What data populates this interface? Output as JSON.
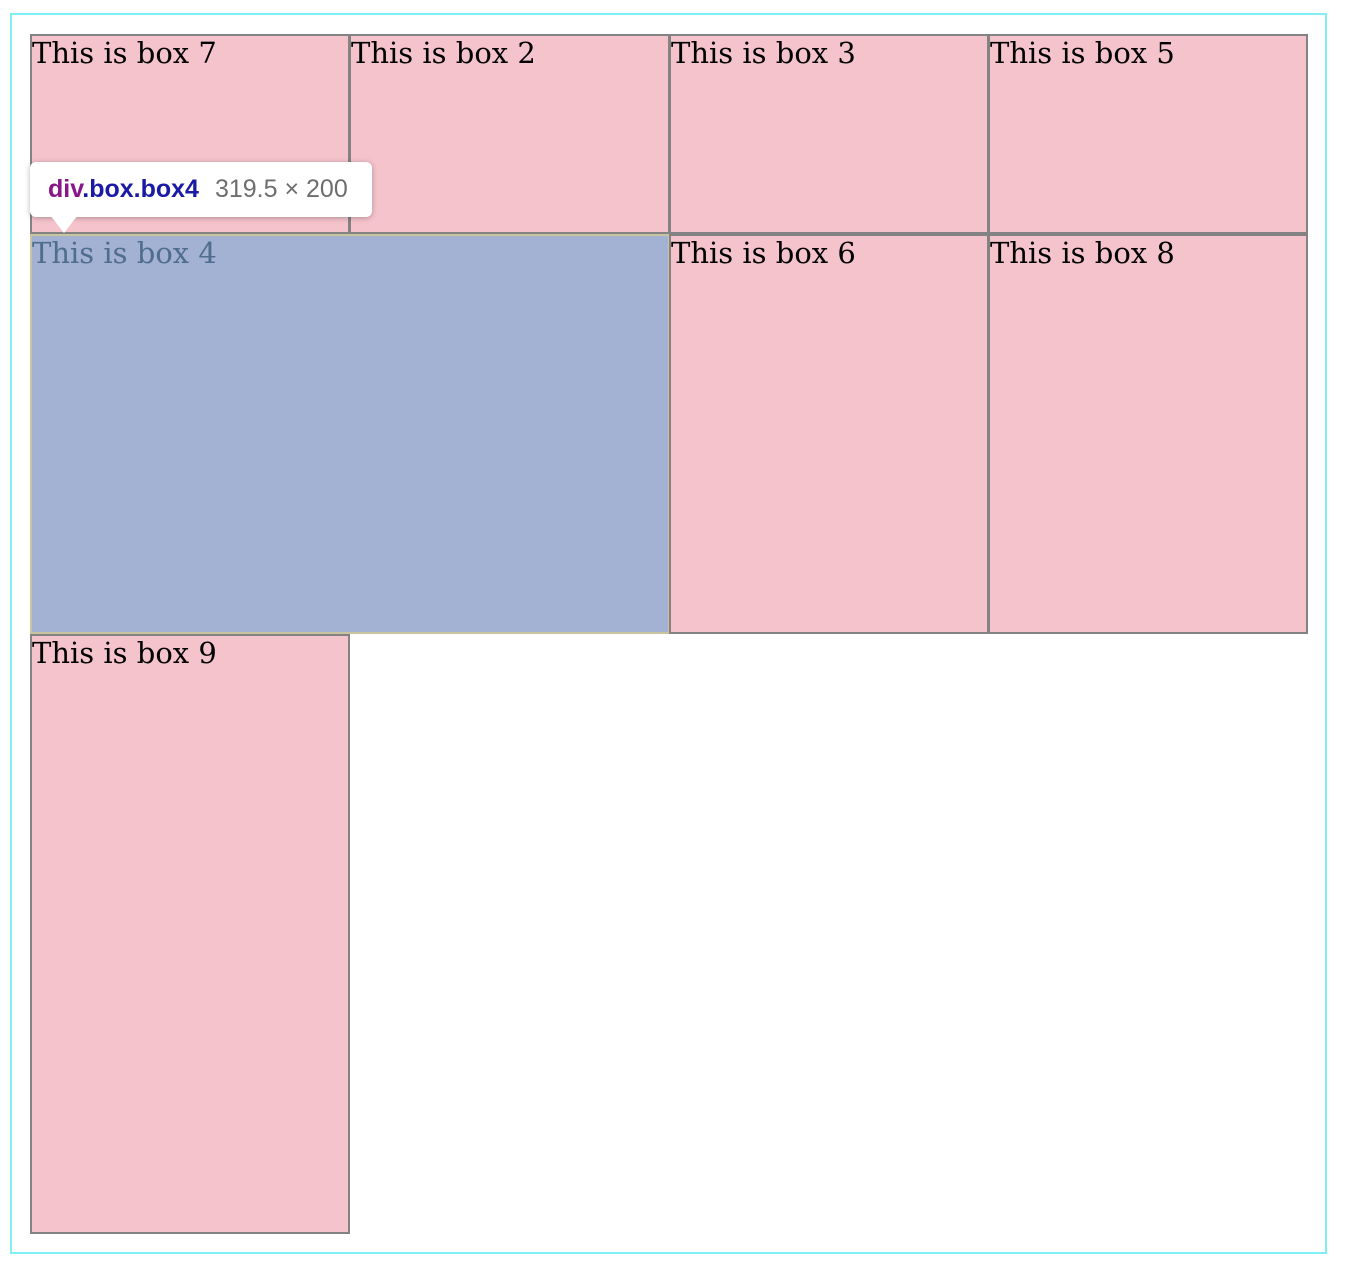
{
  "boxes": {
    "box7": "This is box 7",
    "box2": "This is box 2",
    "box3": "This is box 3",
    "box5": "This is box 5",
    "box4": "This is box 4",
    "box6": "This is box 6",
    "box8": "This is box 8",
    "box9": "This is box 9"
  },
  "tooltip": {
    "tag": "div",
    "classes": ".box.box4",
    "dimensions": "319.5 × 200"
  },
  "colors": {
    "box_fill": "#f5c3cc",
    "box_border": "#838383",
    "highlight_fill": "#a3b1d3",
    "container_border": "#7ff0f3",
    "tooltip_tag": "#88158a",
    "tooltip_class": "#1a1aa6"
  }
}
